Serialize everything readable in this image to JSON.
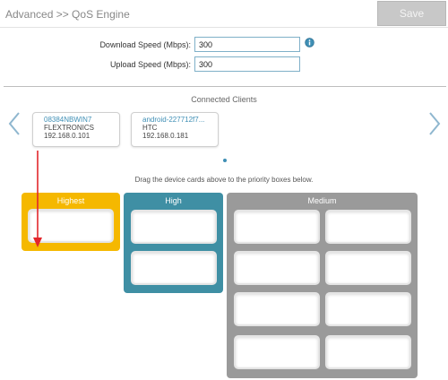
{
  "header": {
    "breadcrumb": "Advanced >> QoS Engine",
    "save_label": "Save"
  },
  "speed": {
    "download_label": "Download Speed (Mbps):",
    "download_value": "300",
    "upload_label": "Upload Speed (Mbps):",
    "upload_value": "300"
  },
  "clients": {
    "title": "Connected Clients",
    "items": [
      {
        "name": "08384NBWIN7",
        "vendor": "FLEXTRONICS",
        "ip": "192.168.0.101"
      },
      {
        "name": "android-227712f7...",
        "vendor": "HTC",
        "ip": "192.168.0.181"
      }
    ]
  },
  "hint": "Drag the device cards above to the priority boxes below.",
  "priority": {
    "highest": "Highest",
    "high": "High",
    "medium": "Medium"
  },
  "colors": {
    "highest": "#f5b800",
    "high": "#3f8fa4",
    "medium": "#9a9a9a",
    "accent": "#3f8fb5",
    "arrow": "#e3262c"
  }
}
